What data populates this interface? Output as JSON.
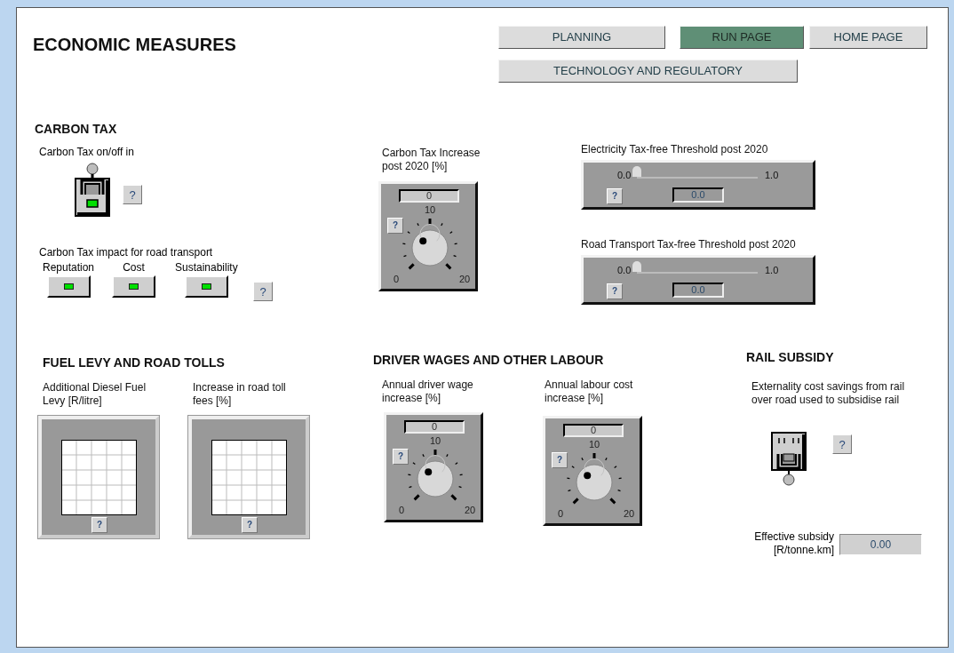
{
  "title": "ECONOMIC MEASURES",
  "nav": [
    {
      "label": "PLANNING",
      "selected": false
    },
    {
      "label": "RUN PAGE",
      "selected": true
    },
    {
      "label": "HOME PAGE",
      "selected": false
    },
    {
      "label": "TECHNOLOGY AND REGULATORY",
      "selected": false
    }
  ],
  "carbon_tax": {
    "heading": "CARBON TAX",
    "switch": {
      "label": "Carbon Tax on/off in",
      "on": true,
      "help": "?"
    },
    "impact": {
      "label": "Carbon Tax impact for road transport",
      "help": "?",
      "toggles": [
        {
          "label": "Reputation",
          "on": true
        },
        {
          "label": "Cost",
          "on": true
        },
        {
          "label": "Sustainability",
          "on": true
        }
      ]
    },
    "increase_knob": {
      "label_lines": [
        "Carbon Tax Increase",
        "post 2020 [%]"
      ],
      "value": "0",
      "min": "0",
      "mid": "10",
      "max": "20",
      "level": 0,
      "help": "?"
    },
    "sliders": [
      {
        "label": "Electricity Tax-free Threshold post 2020",
        "min": "0.0",
        "max": "1.0",
        "value": "0.0",
        "level": 0,
        "help": "?"
      },
      {
        "label": "Road Transport Tax-free Threshold post 2020",
        "min": "0.0",
        "max": "1.0",
        "value": "0.0",
        "level": 0,
        "help": "?"
      }
    ]
  },
  "fuel": {
    "heading": "FUEL LEVY AND ROAD TOLLS",
    "graphs": [
      {
        "label_lines": [
          "Additional Diesel Fuel",
          "Levy [R/litre]"
        ],
        "help": "?"
      },
      {
        "label_lines": [
          "Increase in road toll",
          "fees [%]"
        ],
        "help": "?"
      }
    ]
  },
  "labour": {
    "heading": "DRIVER WAGES AND OTHER LABOUR",
    "knobs": [
      {
        "label_lines": [
          "Annual driver wage",
          "increase [%]"
        ],
        "value": "0",
        "min": "0",
        "mid": "10",
        "max": "20",
        "level": 0,
        "help": "?"
      },
      {
        "label_lines": [
          "Annual labour cost",
          "increase [%]"
        ],
        "value": "0",
        "min": "0",
        "mid": "10",
        "max": "20",
        "level": 0,
        "help": "?"
      }
    ]
  },
  "rail": {
    "heading": "RAIL SUBSIDY",
    "switch": {
      "label_lines": [
        "Externality cost savings from rail",
        "over road used to subsidise rail"
      ],
      "on": false,
      "help": "?"
    },
    "output": {
      "label_lines": [
        "Effective subsidy",
        "[R/tonne.km]"
      ],
      "value": "0.00"
    }
  }
}
